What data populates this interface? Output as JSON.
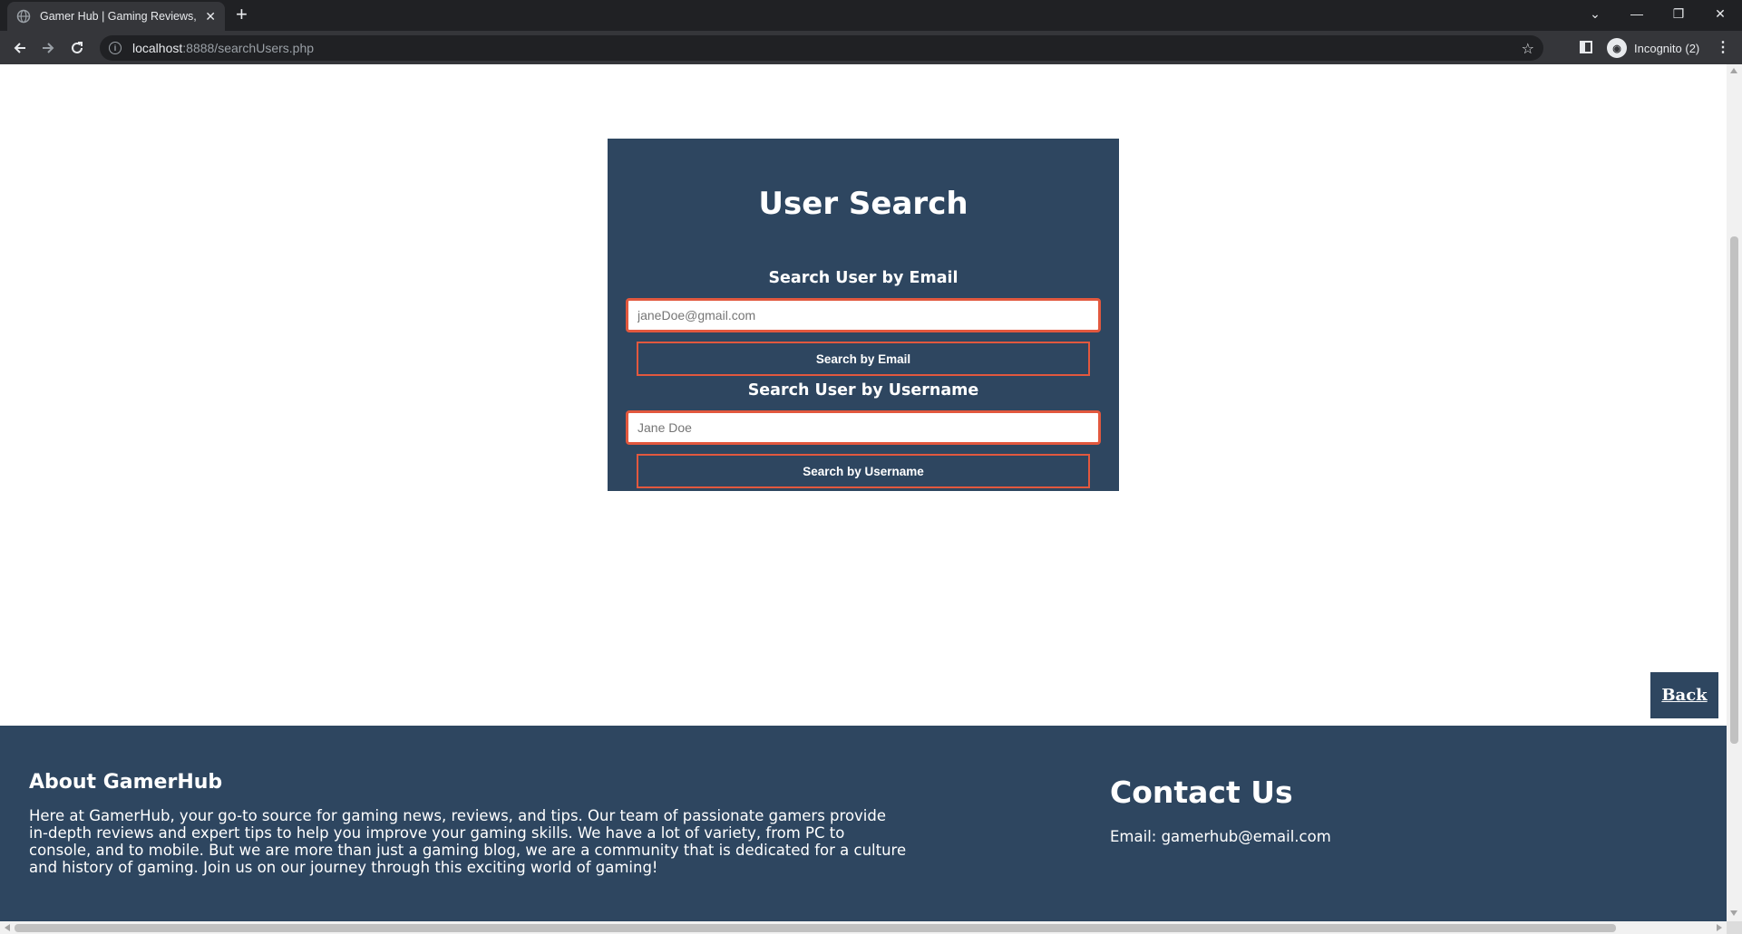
{
  "browser": {
    "tab_title": "Gamer Hub | Gaming Reviews, Tips",
    "tab_close": "✕",
    "new_tab": "+",
    "url_host": "localhost",
    "url_path": ":8888/searchUsers.php",
    "profile_label": "Incognito (2)",
    "window_controls": {
      "tab_search": "⌄",
      "minimize": "—",
      "restore": "❐",
      "close": "✕"
    }
  },
  "search": {
    "title": "User Search",
    "email_section_label": "Search User by Email",
    "email_placeholder": "janeDoe@gmail.com",
    "email_button_label": "Search by Email",
    "username_section_label": "Search User by Username",
    "username_placeholder": "Jane Doe",
    "username_button_label": "Search by Username"
  },
  "back_button_label": "Back",
  "footer": {
    "about_title": "About GamerHub",
    "about_text": "Here at GamerHub, your go-to source for gaming news, reviews, and tips. Our team of passionate gamers provide in-depth reviews and expert tips to help you improve your gaming skills. We have a lot of variety, from PC to console, and to mobile. But we are more than just a gaming blog, we are a community that is dedicated for a culture and history of gaming. Join us on our journey through this exciting world of gaming!",
    "contact_title": "Contact Us",
    "contact_email": "Email: gamerhub@email.com"
  },
  "colors": {
    "card_bg": "#2e4660",
    "accent_border": "#e2583e",
    "chrome_dark": "#202124",
    "chrome_toolbar": "#35363a"
  }
}
